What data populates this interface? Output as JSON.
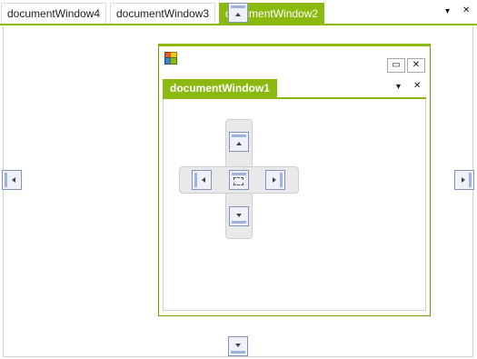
{
  "tabs": [
    {
      "label": "documentWindow4",
      "active": false
    },
    {
      "label": "documentWindow3",
      "active": false
    },
    {
      "label": "documentWindow2",
      "active": true
    }
  ],
  "tab_strip": {
    "dropdown_glyph": "▾",
    "close_glyph": "✕"
  },
  "floating_window": {
    "icon": "window-icon",
    "maximize_glyph": "▭",
    "close_glyph": "✕",
    "tab_label": "documentWindow1",
    "dropdown_glyph": "▾",
    "tab_close_glyph": "✕"
  },
  "colors": {
    "accent": "#8aba10",
    "guide_border": "#8494b4",
    "guide_fill": "#eef1fa"
  },
  "dock_guides": [
    "top",
    "left",
    "right",
    "bottom",
    "center-top",
    "center-left",
    "center-fill",
    "center-right",
    "center-bottom"
  ]
}
